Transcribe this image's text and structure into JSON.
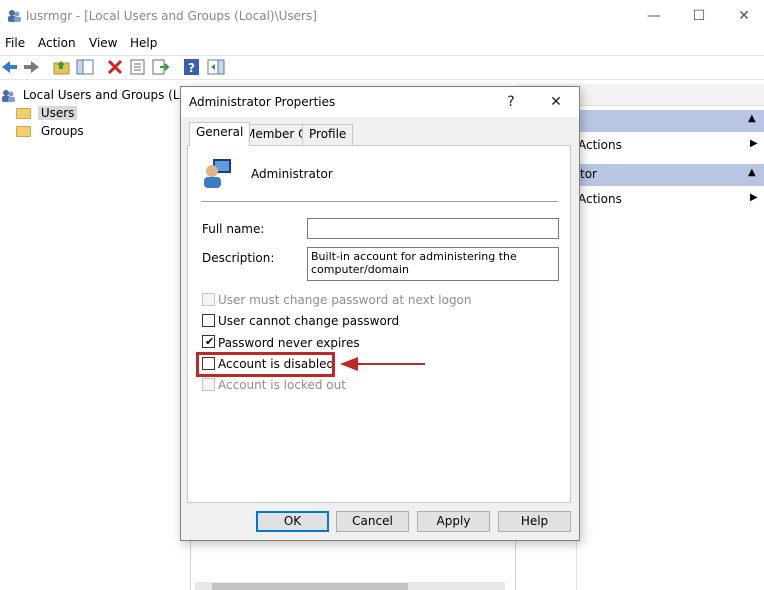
{
  "window": {
    "title": "lusrmgr - [Local Users and Groups (Local)\\Users]",
    "minimize": "—",
    "maximize": "☐",
    "close": "✕"
  },
  "menu": [
    "File",
    "Action",
    "View",
    "Help"
  ],
  "tree": {
    "root": "Local Users and Groups (Local)",
    "children": [
      "Users",
      "Groups"
    ],
    "selected": "Users"
  },
  "actions_pane": {
    "items": [
      "Actions",
      "Actions"
    ]
  },
  "dialog": {
    "title": "Administrator Properties",
    "help": "?",
    "close": "✕",
    "tabs": [
      "General",
      "Member Of",
      "Profile"
    ],
    "active_tab": "General",
    "username": "Administrator",
    "full_name_label": "Full name:",
    "full_name_value": "",
    "description_label": "Description:",
    "description_value": "Built-in account for administering the computer/domain",
    "checkboxes": [
      {
        "label": "User must change password at next logon",
        "checked": false,
        "enabled": false
      },
      {
        "label": "User cannot change password",
        "checked": false,
        "enabled": true
      },
      {
        "label": "Password never expires",
        "checked": true,
        "enabled": true
      },
      {
        "label": "Account is disabled",
        "checked": false,
        "enabled": true
      },
      {
        "label": "Account is locked out",
        "checked": false,
        "enabled": false
      }
    ],
    "buttons": {
      "ok": "OK",
      "cancel": "Cancel",
      "apply": "Apply",
      "help": "Help"
    }
  },
  "annotation": {
    "color": "#c02727"
  },
  "colors": {
    "accent": "#0078d7",
    "actions_header": "#b8c6e4",
    "folder": "#f2cf6d"
  }
}
